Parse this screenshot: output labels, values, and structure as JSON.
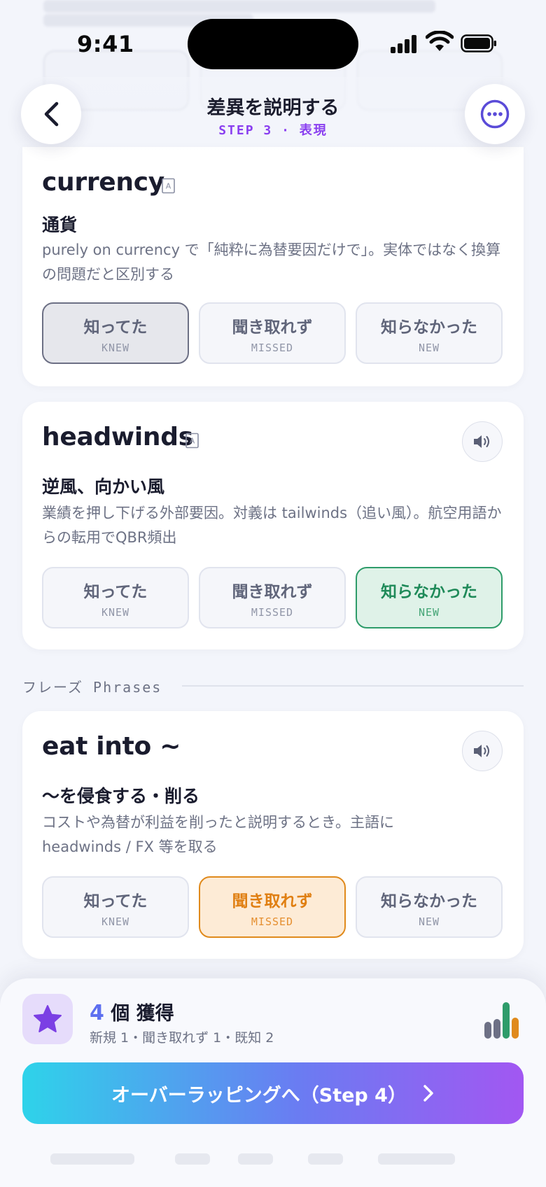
{
  "status_bar": {
    "time": "9:41"
  },
  "header": {
    "title": "差異を説明する",
    "subtitle": "STEP 3 · 表現"
  },
  "option_labels": {
    "knew_jp": "知ってた",
    "knew_en": "KNEW",
    "missed_jp": "聞き取れず",
    "missed_en": "MISSED",
    "new_jp": "知らなかった",
    "new_en": "NEW"
  },
  "cards": [
    {
      "term": "currency",
      "meaning": "通貨",
      "note": "purely on currency で「純粋に為替要因だけで」。実体ではなく換算の問題だと区別する",
      "selected": "knew"
    },
    {
      "term": "headwinds",
      "meaning": "逆風、向かい風",
      "note": "業績を押し下げる外部要因。対義は tailwinds（追い風）。航空用語からの転用でQBR頻出",
      "selected": "new"
    },
    {
      "term": "eat into ~",
      "meaning": "〜を侵食する・削る",
      "note": "コストや為替が利益を削ったと説明するとき。主語に headwinds / FX 等を取る",
      "selected": "missed"
    }
  ],
  "phrases_section": {
    "label": "フレーズ Phrases"
  },
  "summary": {
    "count": "4",
    "count_label": "個 獲得",
    "breakdown": "新規 1・聞き取れず 1・既知 2"
  },
  "cta": {
    "label": "オーバーラッピングへ（Step 4）"
  },
  "colors": {
    "accent_purple": "#8a3ff0",
    "knew": "#6d7085",
    "new": "#2e9c6a",
    "missed": "#e08a1c"
  }
}
